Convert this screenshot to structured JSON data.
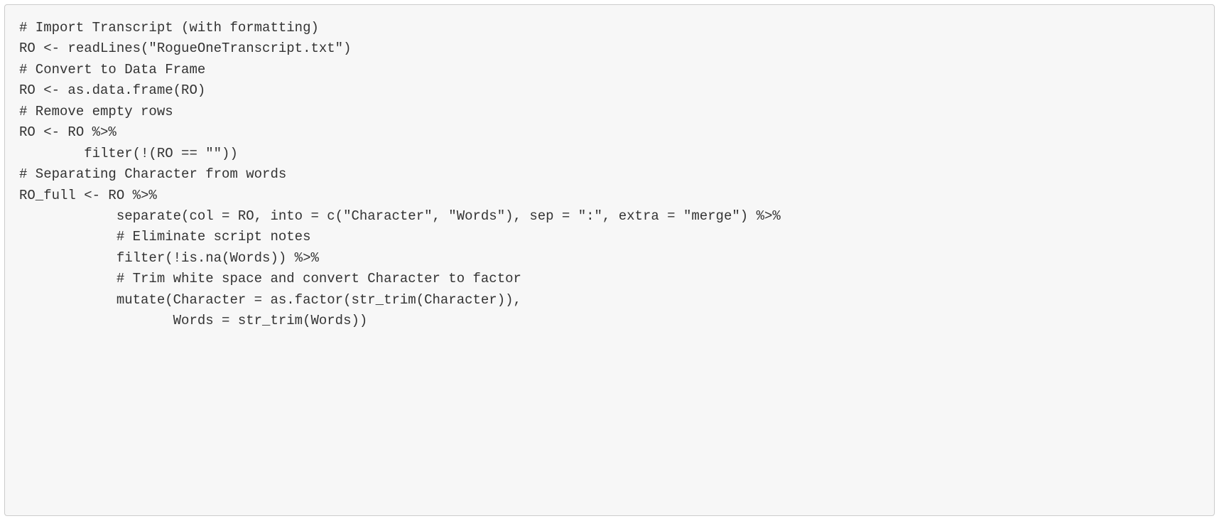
{
  "code": {
    "lines": [
      "# Import Transcript (with formatting)",
      "RO <- readLines(\"RogueOneTranscript.txt\")",
      "",
      "# Convert to Data Frame",
      "RO <- as.data.frame(RO)",
      "",
      "# Remove empty rows",
      "RO <- RO %>%",
      "        filter(!(RO == \"\"))",
      "",
      "# Separating Character from words",
      "RO_full <- RO %>%",
      "            separate(col = RO, into = c(\"Character\", \"Words\"), sep = \":\", extra = \"merge\") %>%",
      "            # Eliminate script notes",
      "            filter(!is.na(Words)) %>%",
      "            # Trim white space and convert Character to factor",
      "            mutate(Character = as.factor(str_trim(Character)),",
      "                   Words = str_trim(Words))"
    ]
  }
}
